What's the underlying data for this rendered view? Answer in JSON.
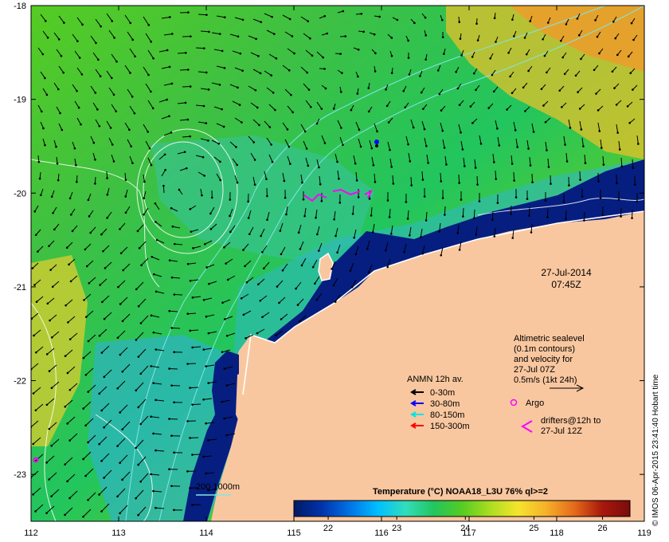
{
  "map": {
    "type": "sea-surface-temperature-map",
    "lon_range": [
      112,
      119
    ],
    "lat_range": [
      -23.5,
      -18
    ],
    "x_ticks": [
      "112",
      "113",
      "114",
      "115",
      "116",
      "117",
      "118",
      "119"
    ],
    "y_ticks": [
      "-18",
      "-19",
      "-20",
      "-21",
      "-22",
      "-23"
    ],
    "date_label": "27-Jul-2014",
    "time_label": "07:45Z",
    "colors": {
      "land": "#f9c79f",
      "coast_outline": "#ffffff",
      "contour": "#ffffff",
      "bathy_200": "#7fe5e5",
      "bathy_1000": "#7fe5e5",
      "argo": "#ff00ff",
      "drifter": "#ff00ff"
    }
  },
  "sealevel_note": {
    "line1": "Altimetric sealevel",
    "line2": "(0.1m contours)",
    "line3": "and velocity for",
    "line4": "27-Jul 07Z",
    "line5": "0.5m/s (1kt 24h)"
  },
  "anmn_legend": {
    "title": "ANMN 12h av.",
    "items": [
      {
        "label": "0-30m",
        "color": "#000000"
      },
      {
        "label": "30-80m",
        "color": "#0000ff"
      },
      {
        "label": "80-150m",
        "color": "#00e5e5"
      },
      {
        "label": "150-300m",
        "color": "#ff0000"
      }
    ]
  },
  "argo_legend": {
    "label": "Argo"
  },
  "drifter_legend": {
    "line1": "drifters@12h to",
    "line2": "27-Jul 12Z"
  },
  "bathy_legend": {
    "label": "200  1000m"
  },
  "colorbar": {
    "title": "Temperature (°C) NOAA18_L3U 76% ql>=2",
    "min": 21.5,
    "max": 26.4,
    "ticks": [
      "22",
      "23",
      "24",
      "25",
      "26"
    ],
    "stops": [
      "#001a66",
      "#0033aa",
      "#0073e6",
      "#00bfff",
      "#33ddbb",
      "#22c55e",
      "#55cc22",
      "#aadd22",
      "#f5e52c",
      "#f5b12a",
      "#e56b1a",
      "#a8180c",
      "#7a0c0c"
    ]
  },
  "credit": "© IMOS 06-Apr-2015 23:41:40 Hobart time"
}
